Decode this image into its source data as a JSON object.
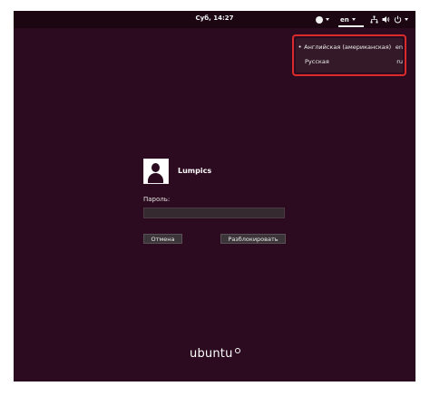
{
  "topbar": {
    "clock": "Суб, 14:27",
    "language_indicator": "en",
    "icons": [
      "accessibility-icon",
      "network-icon",
      "volume-icon",
      "power-icon"
    ]
  },
  "language_menu": {
    "items": [
      {
        "name": "Английская (американская)",
        "code": "en",
        "selected": true
      },
      {
        "name": "Русская",
        "code": "ru",
        "selected": false
      }
    ]
  },
  "login": {
    "username": "Lumpics",
    "password_label": "Пароль:",
    "password_value": "",
    "cancel_label": "Отмена",
    "unlock_label": "Разблокировать"
  },
  "branding": {
    "logo_text": "ubuntu"
  },
  "colors": {
    "background": "#2c0a1f",
    "topbar": "#1c0612",
    "highlight_border": "#d92b2b"
  }
}
